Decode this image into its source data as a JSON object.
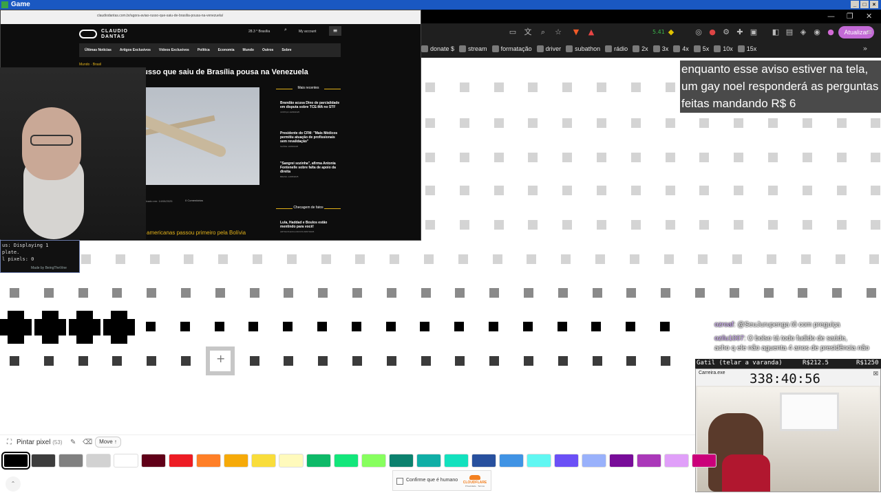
{
  "window": {
    "title": "Game"
  },
  "browser": {
    "update_label": "Atualizar",
    "badge": "5.41",
    "bookmarks": [
      "donate $",
      "stream",
      "formatação",
      "driver",
      "subathon",
      "rádio",
      "2x",
      "3x",
      "4x",
      "5x",
      "10x",
      "15x"
    ]
  },
  "site": {
    "url": "claudiodantas.com.br/agora-aviao-russo-que-saiu-de-brasilia-pousa-na-venezuela/",
    "logo_line1": "CLAUDIO",
    "logo_line2": "DANTAS",
    "weather": "28.3 °  Brasília",
    "account": "My account",
    "nav": [
      "Últimas Notícias",
      "Artigos Exclusivos",
      "Vídeos Exclusivos",
      "Política",
      "Economia",
      "Mundo",
      "Outros",
      "Sobre"
    ],
    "crumbs": "Mundo  ·  Brasil",
    "headline": "AGORA: Avião russo que saiu de Brasília pousa na Venezuela",
    "published": "Publicado em: 14/08/2025",
    "comments": "0 Comentários",
    "subline": "americanas passou primeiro pela Bolívia",
    "sidebar": {
      "recent_title": "Mais recentes",
      "facts_title": "Checagem de fatos",
      "recent": [
        {
          "title": "Brandão acusa Dino de parcialidade em disputa sobre TCE-MA no STF",
          "tag": "JUSTIÇA",
          "date": "14/08/2025"
        },
        {
          "title": "Presidente do CFM: \"Mais Médicos permitiu atuação de profissionais sem revalidação\"",
          "tag": "SAÚDE",
          "date": "14/08/2025"
        },
        {
          "title": "\"Sangrei sozinha\", afirma Antonia Fontenelle sobre falta de apoio da direita",
          "tag": "BRASIL",
          "date": "14/08/2025"
        }
      ],
      "facts": [
        {
          "title": "Lula, Haddad e Boulos estão mentindo para você!",
          "tag": "ARTIGOS EXCLUSIVOS",
          "date": "09/07/2025"
        }
      ]
    }
  },
  "console": {
    "lines": [
      "us: Displaying 1",
      "plate.",
      "l pixels: 0"
    ],
    "made_by": "Made by BeingTheVine"
  },
  "tip_text": "enquanto esse aviso estiver na tela, um gay noel responderá as perguntas feitas mandando R$ 6",
  "chat": [
    {
      "user": "ozroaf",
      "text": ": @SeuJurupenga tô com preguiça"
    },
    {
      "user": "ozilu1007",
      "text": ": O bolso tá todo fudido de saúde,"
    },
    {
      "user": "",
      "text": "acho q ele não aguenta 4 anos de presidência não"
    }
  ],
  "donation": {
    "left": "Gatil (telar a varanda)",
    "mid": "R$212.5",
    "right": "R$1250"
  },
  "timer_window": {
    "title": "Carreira.exe",
    "time": "338:40:56"
  },
  "toolbar": {
    "mode_label": "Pintar pixel",
    "mode_count": "(53)",
    "move_label": "Move ↑",
    "palette": [
      "#000000",
      "#3c3c3c",
      "#808080",
      "#d2d2d2",
      "#ffffff",
      "#600018",
      "#ed1c24",
      "#ff7f27",
      "#f6aa09",
      "#f9dd3b",
      "#fffabc",
      "#0eb968",
      "#13e67b",
      "#87ff5e",
      "#0c816e",
      "#10aea6",
      "#13e1be",
      "#28509e",
      "#4093e4",
      "#60f7f2",
      "#6b50f6",
      "#99b1fb",
      "#780c99",
      "#aa38b9",
      "#e09ff9",
      "#cb007a"
    ],
    "selected_index": 0
  },
  "captcha": {
    "label": "Confirme que é humano",
    "brand": "CLOUDFLARE",
    "links": "Privacidade · Termos"
  }
}
